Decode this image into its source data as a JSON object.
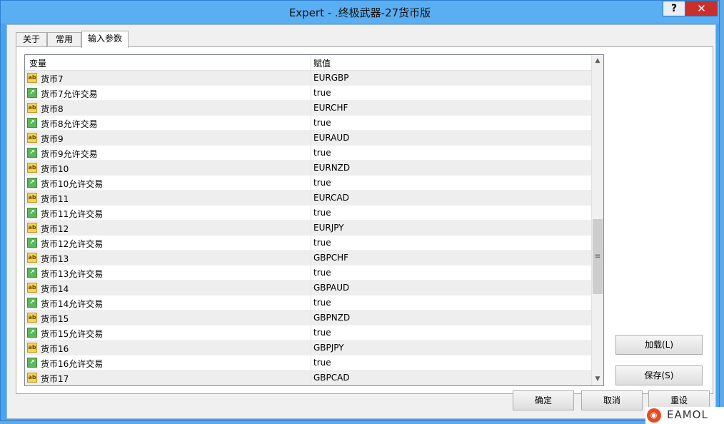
{
  "window": {
    "title": "Expert - .终极武器-27货币版",
    "help_label": "?",
    "close_label": "✕"
  },
  "tabs": [
    {
      "label": "关于"
    },
    {
      "label": "常用"
    },
    {
      "label": "输入参数"
    }
  ],
  "grid": {
    "col_variable": "变量",
    "col_value": "赋值",
    "rows": [
      {
        "name": "货币7",
        "value": "EURGBP",
        "type": "ab"
      },
      {
        "name": "货币7允许交易",
        "value": "true",
        "type": "bool"
      },
      {
        "name": "货币8",
        "value": "EURCHF",
        "type": "ab"
      },
      {
        "name": "货币8允许交易",
        "value": "true",
        "type": "bool"
      },
      {
        "name": "货币9",
        "value": "EURAUD",
        "type": "ab"
      },
      {
        "name": "货币9允许交易",
        "value": "true",
        "type": "bool"
      },
      {
        "name": "货币10",
        "value": "EURNZD",
        "type": "ab"
      },
      {
        "name": "货币10允许交易",
        "value": "true",
        "type": "bool"
      },
      {
        "name": "货币11",
        "value": "EURCAD",
        "type": "ab"
      },
      {
        "name": "货币11允许交易",
        "value": "true",
        "type": "bool"
      },
      {
        "name": "货币12",
        "value": "EURJPY",
        "type": "ab"
      },
      {
        "name": "货币12允许交易",
        "value": "true",
        "type": "bool"
      },
      {
        "name": "货币13",
        "value": "GBPCHF",
        "type": "ab"
      },
      {
        "name": "货币13允许交易",
        "value": "true",
        "type": "bool"
      },
      {
        "name": "货币14",
        "value": "GBPAUD",
        "type": "ab"
      },
      {
        "name": "货币14允许交易",
        "value": "true",
        "type": "bool"
      },
      {
        "name": "货币15",
        "value": "GBPNZD",
        "type": "ab"
      },
      {
        "name": "货币15允许交易",
        "value": "true",
        "type": "bool"
      },
      {
        "name": "货币16",
        "value": "GBPJPY",
        "type": "ab"
      },
      {
        "name": "货币16允许交易",
        "value": "true",
        "type": "bool"
      },
      {
        "name": "货币17",
        "value": "GBPCAD",
        "type": "ab"
      }
    ]
  },
  "icons": {
    "string_glyph": "ab",
    "bool_glyph": "↗"
  },
  "buttons": {
    "load": "加载(L)",
    "save": "保存(S)",
    "ok": "确定",
    "cancel": "取消",
    "reset": "重设"
  },
  "watermark": {
    "text": "EAMOL"
  }
}
